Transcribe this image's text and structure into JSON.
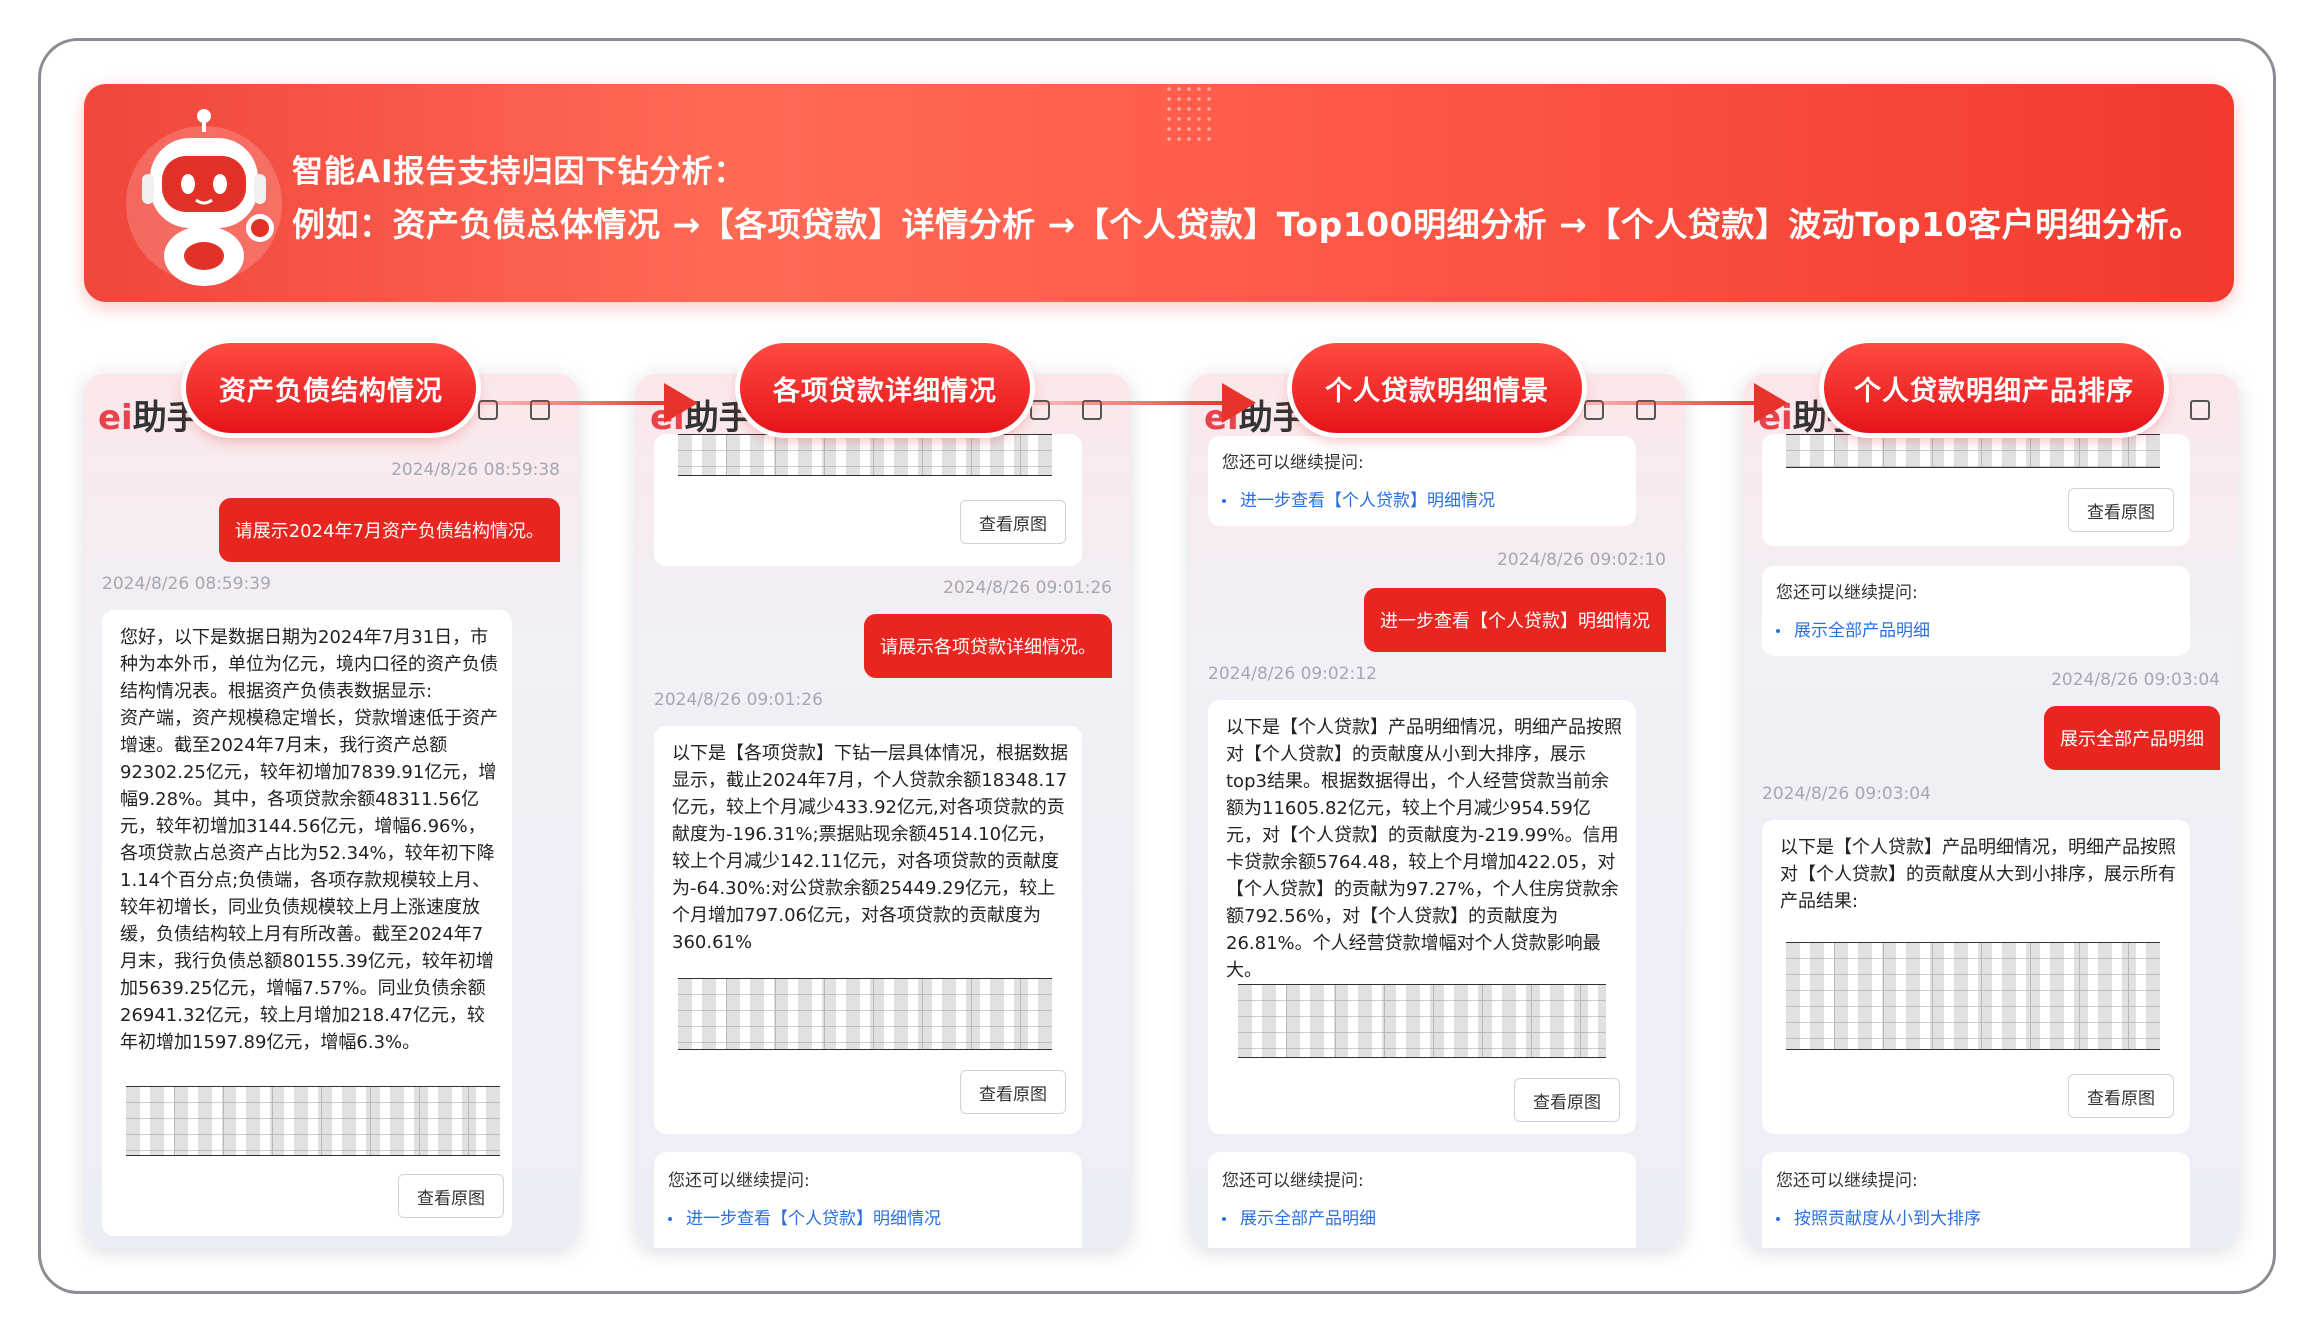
{
  "banner": {
    "line1": "智能AI报告支持归因下钻分析：",
    "line2": "例如：资产负债总体情况 →【各项贷款】详情分析 →【个人贷款】Top100明细分析 →【个人贷款】波动Top10客户明细分析。"
  },
  "brand": {
    "logo_text": "助手",
    "logo_mark": "ei"
  },
  "steps": [
    {
      "label": "资产负债结构情况"
    },
    {
      "label": "各项贷款详细情况"
    },
    {
      "label": "个人贷款明细情景"
    },
    {
      "label": "个人贷款明细产品排序"
    }
  ],
  "panel1": {
    "ts1": "2024/8/26 08:59:38",
    "user": "请展示2024年7月资产负债结构情况。",
    "ts2": "2024/8/26 08:59:39",
    "reply": "您好，以下是数据日期为2024年7月31日，市种为本外币，单位为亿元，境内口径的资产负债结构情况表。根据资产负债表数据显示:\n资产端，资产规模稳定增长，贷款增速低于资产增速。截至2024年7月末，我行资产总额92302.25亿元，较年初增加7839.91亿元，增幅9.28%。其中，各项贷款余额48311.56亿元，较年初增加3144.56亿元，增幅6.96%，各项贷款占总资产占比为52.34%，较年初下降1.14个百分点;负债端，各项存款规模较上月、较年初增长，同业负债规模较上月上涨速度放缓，负债结构较上月有所改善。截至2024年7月末，我行负债总额80155.39亿元，较年初增加5639.25亿元，增幅7.57%。同业负债余额26941.32亿元，较上月增加218.47亿元，较年初增加1597.89亿元，增幅6.3%。",
    "view_btn": "查看原图"
  },
  "panel2": {
    "view_btn_top": "查看原图",
    "ts1": "2024/8/26 09:01:26",
    "user": "请展示各项贷款详细情况。",
    "ts2": "2024/8/26 09:01:26",
    "reply": "以下是【各项贷款】下钻一层具体情况，根据数据显示，截止2024年7月，个人贷款余额18348.17亿元，较上个月减少433.92亿元,对各项贷款的贡献度为-196.31%;票据贴现余额4514.10亿元，较上个月减少142.11亿元，对各项贷款的贡献度为-64.30%:对公贷款余额25449.29亿元，较上个月增加797.06亿元，对各项贷款的贡献度为360.61%",
    "view_btn": "查看原图",
    "sugg_title": "您还可以继续提问:",
    "sugg_link": "进一步查看【个人贷款】明细情况"
  },
  "panel3": {
    "sugg_title_top": "您还可以继续提问:",
    "sugg_link_top": "进一步查看【个人贷款】明细情况",
    "ts1": "2024/8/26 09:02:10",
    "user": "进一步查看【个人贷款】明细情况",
    "ts2": "2024/8/26 09:02:12",
    "reply": "以下是【个人贷款】产品明细情况，明细产品按照对【个人贷款】的贡献度从小到大排序，展示top3结果。根据数据得出，个人经营贷款当前余额为11605.82亿元，较上个月减少954.59亿元，对【个人贷款】的贡献度为-219.99%。信用卡贷款余额5764.48，较上个月增加422.05，对【个人贷款】的贡献为97.27%，个人住房贷款余额792.56%，对【个人贷款】的贡献度为26.81%。个人经营贷款增幅对个人贷款影响最大。",
    "view_btn": "查看原图",
    "sugg_title": "您还可以继续提问:",
    "sugg_link": "展示全部产品明细"
  },
  "panel4": {
    "view_btn_top": "查看原图",
    "sugg_title_top": "您还可以继续提问:",
    "sugg_link_top": "展示全部产品明细",
    "ts1": "2024/8/26 09:03:04",
    "user": "展示全部产品明细",
    "ts2": "2024/8/26 09:03:04",
    "reply": "以下是【个人贷款】产品明细情况，明细产品按照对【个人贷款】的贡献度从大到小排序，展示所有产品结果:",
    "view_btn": "查看原图",
    "sugg_title": "您还可以继续提问:",
    "sugg_link": "按照贡献度从小到大排序"
  }
}
